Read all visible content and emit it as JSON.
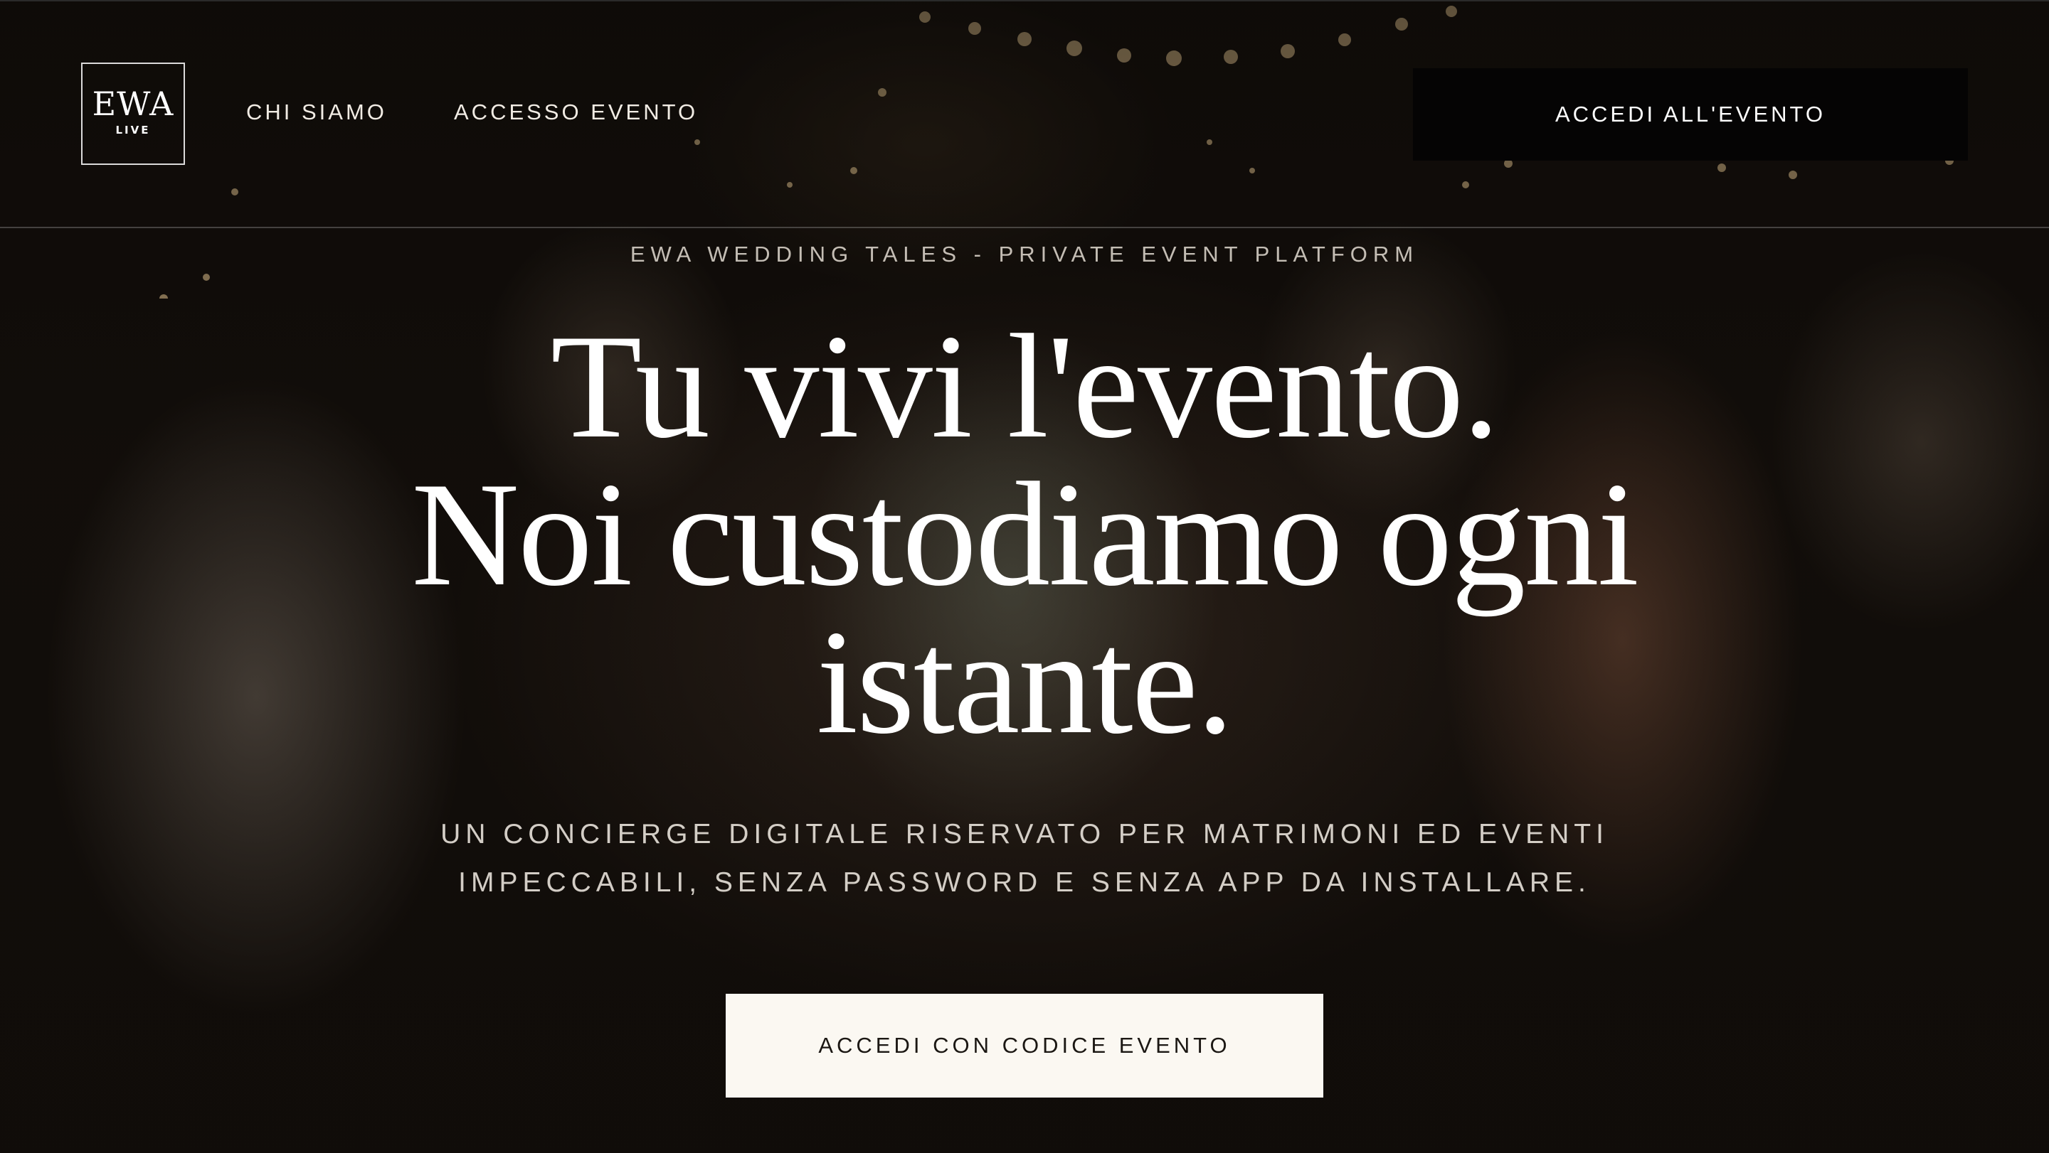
{
  "header": {
    "logo_main": "EWA",
    "logo_sub": "LIVE",
    "nav": [
      {
        "label": "CHI SIAMO"
      },
      {
        "label": "ACCESSO EVENTO"
      }
    ],
    "cta_label": "ACCEDI ALL'EVENTO"
  },
  "hero": {
    "kicker": "EWA WEDDING TALES - PRIVATE EVENT PLATFORM",
    "headline_lines": [
      "Tu vivi l'evento.",
      "Noi custodiamo ogni",
      "istante."
    ],
    "subtitle_lines": [
      "UN CONCIERGE DIGITALE RISERVATO PER MATRIMONI ED EVENTI",
      "IMPECCABILI, SENZA PASSWORD E SENZA APP DA INSTALLARE."
    ],
    "cta_label": "ACCEDI CON CODICE EVENTO"
  },
  "colors": {
    "header_cta_bg": "#050404",
    "main_cta_bg": "#fbf8f2",
    "text_light": "#ffffff"
  }
}
